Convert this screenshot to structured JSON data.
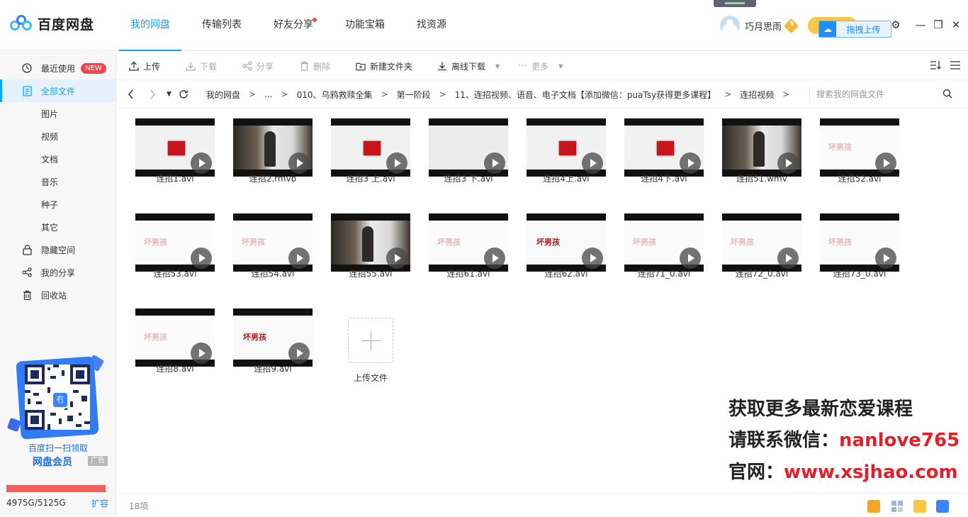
{
  "app": {
    "name": "百度网盘"
  },
  "topnav": [
    {
      "label": "我的网盘",
      "active": true
    },
    {
      "label": "传输列表"
    },
    {
      "label": "好友分享",
      "dot": true
    },
    {
      "label": "功能宝箱"
    },
    {
      "label": "找资源"
    }
  ],
  "user": {
    "name": "巧月思雨",
    "badge": "S"
  },
  "upload_float": {
    "label": "拖拽上传"
  },
  "window_controls": {
    "settings": "⚙",
    "minimize": "—",
    "restore": "❐",
    "close": "✕"
  },
  "sidebar": {
    "items": [
      {
        "label": "最近使用",
        "icon": "clock-icon",
        "tag": "NEW"
      },
      {
        "label": "全部文件",
        "icon": "file-icon",
        "active": true
      },
      {
        "label": "图片",
        "sub": true
      },
      {
        "label": "视频",
        "sub": true
      },
      {
        "label": "文档",
        "sub": true
      },
      {
        "label": "音乐",
        "sub": true
      },
      {
        "label": "种子",
        "sub": true
      },
      {
        "label": "其它",
        "sub": true
      },
      {
        "label": "隐藏空间",
        "icon": "lock-icon"
      },
      {
        "label": "我的分享",
        "icon": "share-icon"
      },
      {
        "label": "回收站",
        "icon": "trash-icon"
      }
    ],
    "promo": {
      "line1": "百度扫一扫领取",
      "line2": "网盘会员",
      "ad": "广告",
      "qr_center": "冇"
    },
    "quota": {
      "text": "4975G/5125G",
      "fraction": 0.971,
      "expand": "扩容"
    }
  },
  "toolbar": {
    "upload": "上传",
    "download": "下载",
    "share": "分享",
    "delete": "删除",
    "new_folder": "新建文件夹",
    "offline_download": "离线下载",
    "more": "更多"
  },
  "crumbbar": {
    "path": [
      "我的网盘",
      "...",
      "010、乌鸦救赎全集",
      "第一阶段",
      "11、连招视频、语音、电子文档【添加微信：puaTsy获得更多课程】",
      "连招视频"
    ],
    "search_placeholder": "搜索我的网盘文件"
  },
  "files": [
    {
      "name": "连招1.avi",
      "thumb": "red"
    },
    {
      "name": "连招2.rmvb",
      "thumb": "video"
    },
    {
      "name": "连招3 上.avi",
      "thumb": "red"
    },
    {
      "name": "连招3 下.avi",
      "thumb": "blank"
    },
    {
      "name": "连招4上.avi",
      "thumb": "red"
    },
    {
      "name": "连招4下.avi",
      "thumb": "red"
    },
    {
      "name": "连招51.wmv",
      "thumb": "video"
    },
    {
      "name": "连招52.avi",
      "thumb": "logo-faint"
    },
    {
      "name": "连招53.avi",
      "thumb": "logo-faint"
    },
    {
      "name": "连招54.avi",
      "thumb": "logo-faint"
    },
    {
      "name": "连招55.avi",
      "thumb": "video"
    },
    {
      "name": "连招61.avi",
      "thumb": "logo-faint"
    },
    {
      "name": "连招62.avi",
      "thumb": "logo-strong"
    },
    {
      "name": "连招71_0.avi",
      "thumb": "logo-faint"
    },
    {
      "name": "连招72_0.avi",
      "thumb": "logo-faint"
    },
    {
      "name": "连招73_0.avi",
      "thumb": "logo-faint"
    },
    {
      "name": "连招8.avi",
      "thumb": "logo-faint"
    },
    {
      "name": "连招9.avi",
      "thumb": "logo-strong"
    }
  ],
  "thumb_brand": "坏男孩",
  "upload_tile": {
    "label": "上传文件"
  },
  "watermark": {
    "line1": "获取更多最新恋爱课程",
    "line2_prefix": "请联系微信：",
    "line2_value": "nanlove765",
    "line3_prefix": "官网：",
    "line3_value": "www.xsjhao.com"
  },
  "status": {
    "count": "18项"
  },
  "colors": {
    "accent": "#06a7ff",
    "alert": "#f5434e",
    "watermark_red": "#e0202a"
  }
}
